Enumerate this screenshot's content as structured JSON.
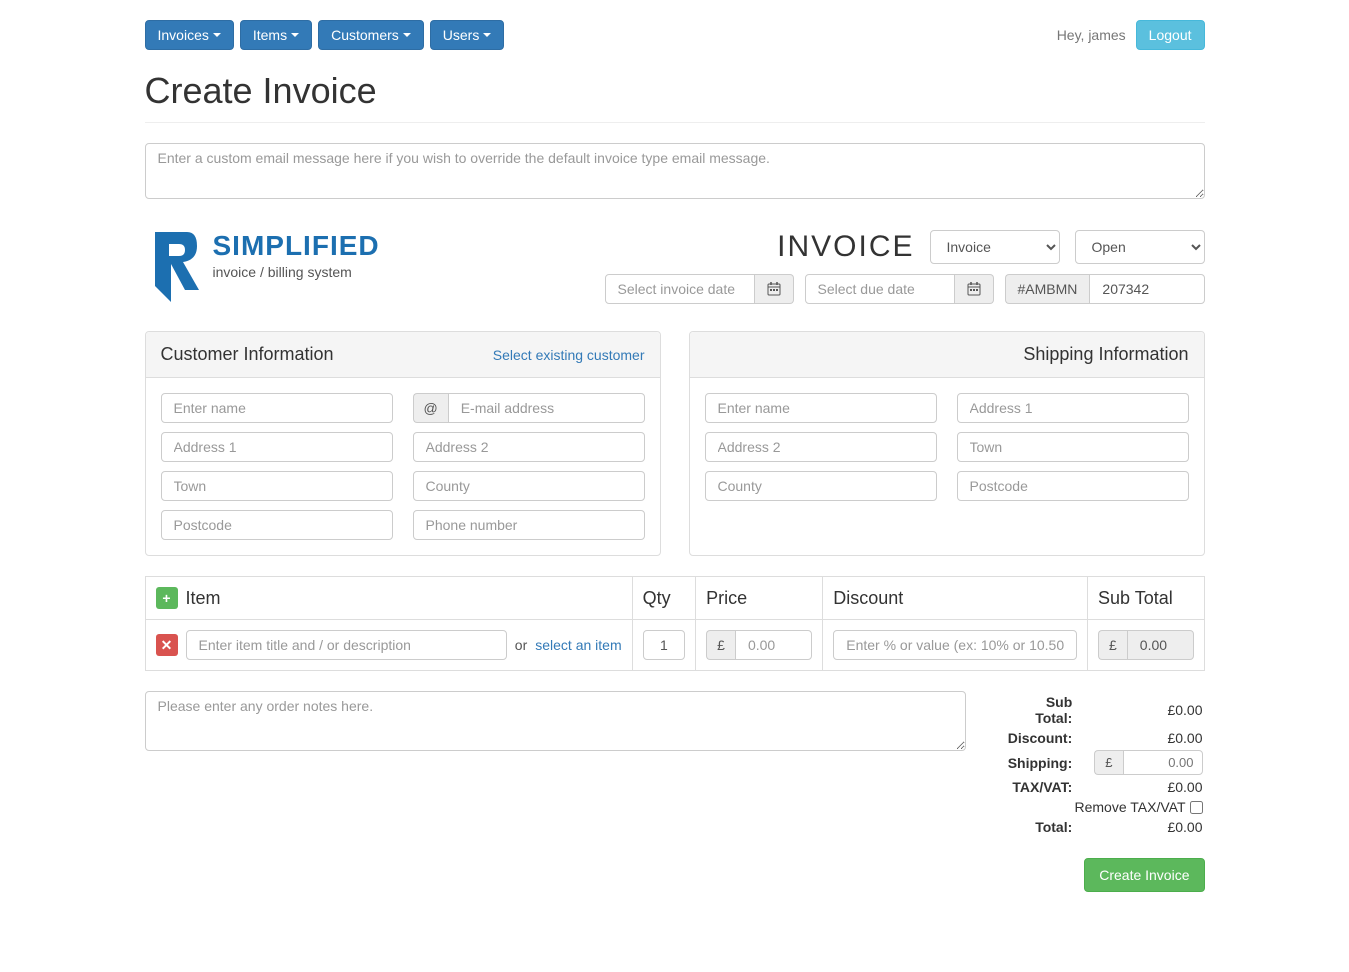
{
  "nav": {
    "invoices": "Invoices",
    "items": "Items",
    "customers": "Customers",
    "users": "Users"
  },
  "greeting": "Hey, james",
  "logout": "Logout",
  "page_title": "Create Invoice",
  "email_placeholder": "Enter a custom email message here if you wish to override the default invoice type email message.",
  "logo": {
    "main": "SIMPLIFIED",
    "sub": "invoice / billing system"
  },
  "invoice_heading": "INVOICE",
  "type_select": "Invoice",
  "status_select": "Open",
  "invoice_date_placeholder": "Select invoice date",
  "due_date_placeholder": "Select due date",
  "invoice_prefix": "#AMBMN",
  "invoice_number": "207342",
  "customer_panel": {
    "title": "Customer Information",
    "link": "Select existing customer",
    "placeholders": {
      "name": "Enter name",
      "email": "E-mail address",
      "address1": "Address 1",
      "address2": "Address 2",
      "town": "Town",
      "county": "County",
      "postcode": "Postcode",
      "phone": "Phone number",
      "at": "@"
    }
  },
  "shipping_panel": {
    "title": "Shipping Information",
    "placeholders": {
      "name": "Enter name",
      "address1": "Address 1",
      "address2": "Address 2",
      "town": "Town",
      "county": "County",
      "postcode": "Postcode"
    }
  },
  "items_table": {
    "headers": {
      "item": "Item",
      "qty": "Qty",
      "price": "Price",
      "discount": "Discount",
      "subtotal": "Sub Total"
    },
    "row": {
      "item_placeholder": "Enter item title and / or description",
      "or": "or",
      "select_link": "select an item",
      "qty": "1",
      "currency": "£",
      "price_placeholder": "0.00",
      "discount_placeholder": "Enter % or value (ex: 10% or 10.50)",
      "subtotal": "0.00"
    }
  },
  "notes_placeholder": "Please enter any order notes here.",
  "totals": {
    "subtotal_label": "Sub Total:",
    "subtotal_value": "£0.00",
    "discount_label": "Discount:",
    "discount_value": "£0.00",
    "shipping_label": "Shipping:",
    "shipping_currency": "£",
    "shipping_value": "0.00",
    "tax_label": "TAX/VAT:",
    "tax_value": "£0.00",
    "remove_tax": "Remove TAX/VAT",
    "total_label": "Total:",
    "total_value": "£0.00"
  },
  "create_button": "Create Invoice"
}
